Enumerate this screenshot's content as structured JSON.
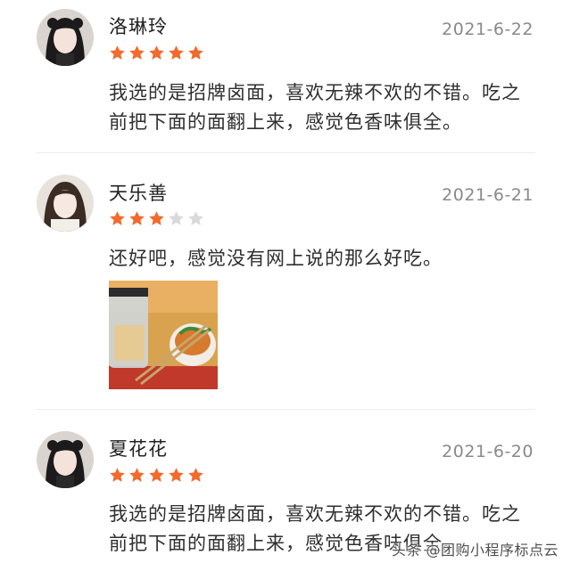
{
  "colors": {
    "star_on": "#f26a2c",
    "star_off": "#d9d9d9"
  },
  "reviews": [
    {
      "name": "洛琳玲",
      "date": "2021-6-22",
      "rating": 5,
      "text": "我选的是招牌卤面，喜欢无辣不欢的不错。吃之前把下面的面翻上来，感觉色香味俱全。"
    },
    {
      "name": "天乐善",
      "date": "2021-6-21",
      "rating": 3,
      "text": "还好吧，感觉没有网上说的那么好吃。",
      "photo_icon": "food-photo"
    },
    {
      "name": "夏花花",
      "date": "2021-6-20",
      "rating": 5,
      "text": "我选的是招牌卤面，喜欢无辣不欢的不错。吃之前把下面的面翻上来，感觉色香味俱全。"
    }
  ],
  "watermark": "头条 @团购小程序标点云"
}
